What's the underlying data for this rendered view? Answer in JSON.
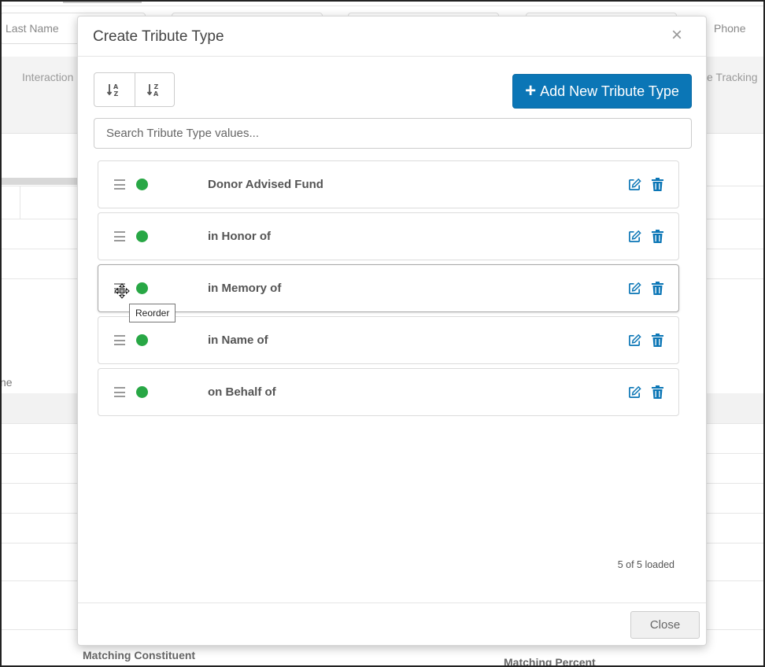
{
  "background": {
    "header_left": "Last Name",
    "header_right": "Phone",
    "band_left": "Interaction",
    "band_right": "e Tracking",
    "side_text": "ne",
    "bottom_left": "Matching Constituent",
    "bottom_right": "Matching Percent"
  },
  "modal": {
    "title": "Create Tribute Type",
    "close_symbol": "×",
    "add_button_label": "Add New Tribute Type",
    "add_button_plus": "+",
    "search_placeholder": "Search Tribute Type values...",
    "search_value": "",
    "items": [
      {
        "label": "Donor Advised Fund",
        "status_color": "#28a745"
      },
      {
        "label": "in Honor of",
        "status_color": "#28a745"
      },
      {
        "label": "in Memory of",
        "status_color": "#28a745"
      },
      {
        "label": "in Name of",
        "status_color": "#28a745"
      },
      {
        "label": "on Behalf of",
        "status_color": "#28a745"
      }
    ],
    "tooltip": "Reorder",
    "loaded_text": "5 of 5 loaded",
    "close_button_label": "Close"
  },
  "colors": {
    "accent": "#0b76b6",
    "icon_blue": "#0b76b6",
    "status_active": "#28a745"
  },
  "icons": {
    "sort_asc": "sort-alpha-asc-icon",
    "sort_desc": "sort-alpha-desc-icon",
    "drag": "drag-handle-icon",
    "edit": "edit-icon",
    "delete": "trash-icon",
    "cursor": "move-cursor-icon"
  }
}
